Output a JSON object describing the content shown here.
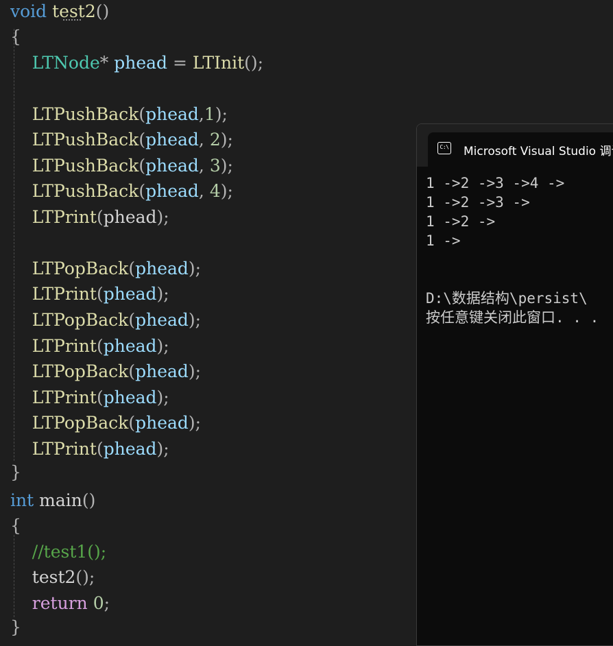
{
  "editor": {
    "lines": {
      "l1": {
        "kw": "void",
        "fn": "test2",
        "p": "()"
      },
      "l2": {
        "p": "{"
      },
      "l3": {
        "type": "LTNode",
        "p1": "* ",
        "var": "phead",
        "p2": " = ",
        "fn": "LTInit",
        "p3": "();"
      },
      "l4": {
        "fn": "LTPushBack",
        "p1": "(",
        "var": "phead",
        "p2": ",",
        "num": "1",
        "p3": ");"
      },
      "l5": {
        "fn": "LTPushBack",
        "p1": "(",
        "var": "phead",
        "p2": ", ",
        "num": "2",
        "p3": ");"
      },
      "l6": {
        "fn": "LTPushBack",
        "p1": "(",
        "var": "phead",
        "p2": ", ",
        "num": "3",
        "p3": ");"
      },
      "l7": {
        "fn": "LTPushBack",
        "p1": "(",
        "var": "phead",
        "p2": ", ",
        "num": "4",
        "p3": ");"
      },
      "l8": {
        "fn": "LTPrint",
        "p1": "(",
        "var": "phead",
        "p2": ");"
      },
      "l9": {
        "fn": "LTPopBack",
        "p1": "(",
        "var": "phead",
        "p2": ");"
      },
      "l10": {
        "fn": "LTPrint",
        "p1": "(",
        "var": "phead",
        "p2": ");"
      },
      "l11": {
        "fn": "LTPopBack",
        "p1": "(",
        "var": "phead",
        "p2": ");"
      },
      "l12": {
        "fn": "LTPrint",
        "p1": "(",
        "var": "phead",
        "p2": ");"
      },
      "l13": {
        "fn": "LTPopBack",
        "p1": "(",
        "var": "phead",
        "p2": ");"
      },
      "l14": {
        "fn": "LTPrint",
        "p1": "(",
        "var": "phead",
        "p2": ");"
      },
      "l15": {
        "fn": "LTPopBack",
        "p1": "(",
        "var": "phead",
        "p2": ");"
      },
      "l16": {
        "fn": "LTPrint",
        "p1": "(",
        "var": "phead",
        "p2": ");"
      },
      "l17": {
        "p": "}"
      },
      "l18": {
        "kw": "int",
        "fn": "main",
        "p": "()"
      },
      "l19": {
        "p": "{"
      },
      "l20": {
        "cmt": "//test1();"
      },
      "l21": {
        "fn": "test2",
        "p": "();"
      },
      "l22": {
        "kw": "return",
        "num": "0",
        "p": ";"
      },
      "l23": {
        "p": "}"
      }
    }
  },
  "console": {
    "title": "Microsoft Visual Studio 调试控制台",
    "icon_label": "C:\\",
    "icon": "console-icon",
    "output": [
      "1 ->2 ->3 ->4 ->",
      "1 ->2 ->3 ->",
      "1 ->2 ->",
      "1 ->",
      "",
      "",
      "D:\\数据结构\\persist\\",
      "按任意键关闭此窗口. . ."
    ]
  },
  "colors": {
    "background": "#1e1e1e",
    "keyword": "#569cd6",
    "control_keyword": "#d8a0df",
    "type": "#4ec9b0",
    "function": "#dcdcaa",
    "variable": "#9cdcfe",
    "number": "#b5cea8",
    "comment": "#57a64a",
    "console_background": "#0c0c0c"
  }
}
